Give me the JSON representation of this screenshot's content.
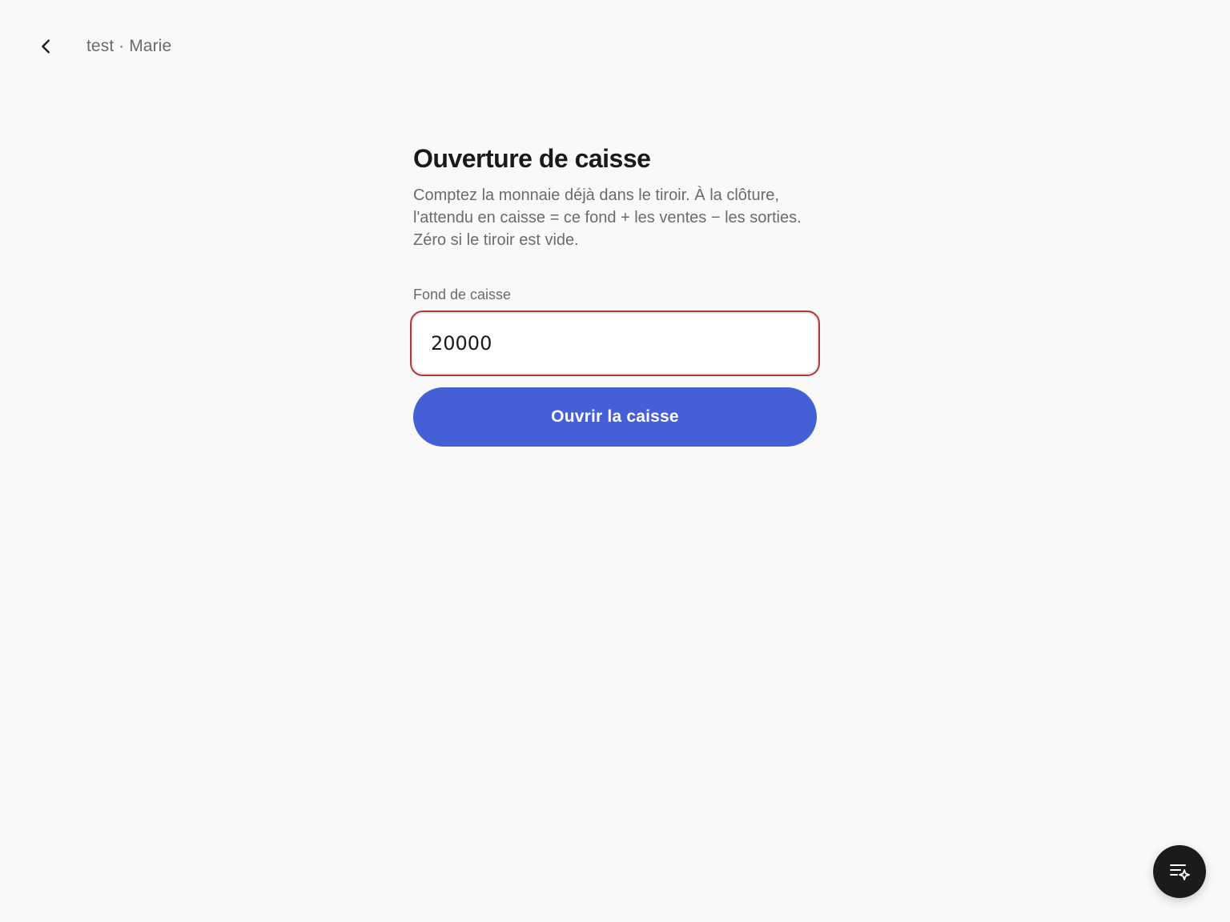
{
  "header": {
    "back_icon": "chevron-left-icon",
    "breadcrumb": "test · Marie"
  },
  "main": {
    "title": "Ouverture de caisse",
    "description": "Comptez la monnaie déjà dans le tiroir. À la clôture, l'attendu en caisse = ce fond + les ventes − les sorties. Zéro si le tiroir est vide.",
    "field_label": "Fond de caisse",
    "field_value": "20000",
    "submit_label": "Ouvrir la caisse"
  },
  "fab": {
    "icon": "list-sparkle-icon"
  },
  "colors": {
    "background": "#f9f9f8",
    "primary": "#455fd6",
    "input_border_error": "#b0393c",
    "fab_background": "#1b1b1b",
    "muted_text": "#6b6b6b"
  }
}
